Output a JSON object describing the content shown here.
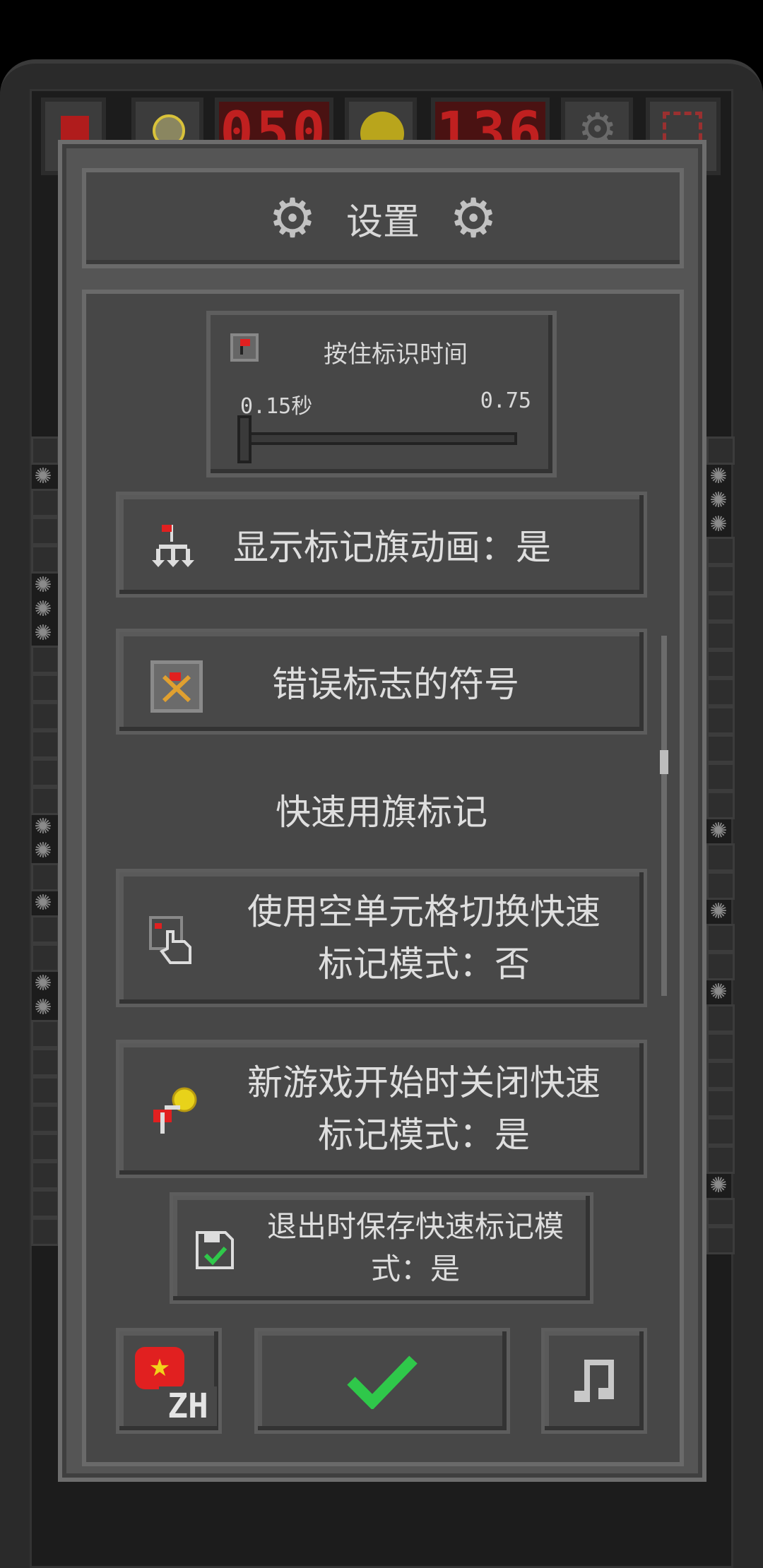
{
  "top_bar": {
    "mine_counter": "050",
    "time_counter": "136"
  },
  "dialog": {
    "title": "设置",
    "hold_flag": {
      "label": "按住标识时间",
      "min_value": "0.15秒",
      "max_value": "0.75",
      "slider_value": 0.0
    },
    "show_flag_animation": "显示标记旗动画：是",
    "wrong_flag_symbol": "错误标志的符号",
    "quick_flag_heading": "快速用旗标记",
    "empty_cell_toggle": {
      "line1": "使用空单元格切换快速",
      "line2": "标记模式：否"
    },
    "new_game_close": {
      "line1": "新游戏开始时关闭快速",
      "line2": "标记模式：是"
    },
    "save_on_exit": {
      "line1": "退出时保存快速标记模",
      "line2": "式：是"
    },
    "language_code": "ZH"
  },
  "colors": {
    "accent_green": "#2fc84a",
    "flag_red": "#e12020",
    "yellow": "#e8d21a"
  },
  "icons": {
    "gear": "gear-icon",
    "flag": "flag-icon",
    "wrong_flag": "wrong-flag-icon",
    "tap": "tap-hand-icon",
    "coin": "coin-flag-icon",
    "save": "save-check-icon",
    "confirm": "checkmark-icon",
    "music": "music-note-icon"
  }
}
